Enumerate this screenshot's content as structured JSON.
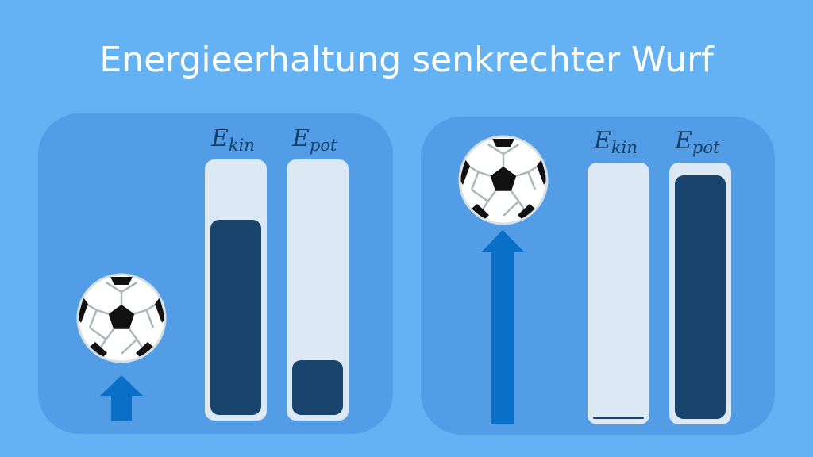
{
  "title": "Energieerhaltung senkrechter Wurf",
  "colors": {
    "background": "#64b2f4",
    "panel": "#529de6",
    "bar_track": "#dde8f5",
    "bar_fill": "#19446d",
    "arrow": "#0a6fc6",
    "label": "#173f66"
  },
  "panels": [
    {
      "ball_icon": "soccer-ball-icon",
      "arrow_icon": "up-arrow-icon",
      "bars": [
        {
          "symbol": "E",
          "subscript": "kin",
          "level": 0.78
        },
        {
          "symbol": "E",
          "subscript": "pot",
          "level": 0.22
        }
      ]
    },
    {
      "ball_icon": "soccer-ball-icon",
      "arrow_icon": "up-arrow-icon",
      "bars": [
        {
          "symbol": "E",
          "subscript": "kin",
          "level": 0.01
        },
        {
          "symbol": "E",
          "subscript": "pot",
          "level": 0.97
        }
      ]
    }
  ]
}
